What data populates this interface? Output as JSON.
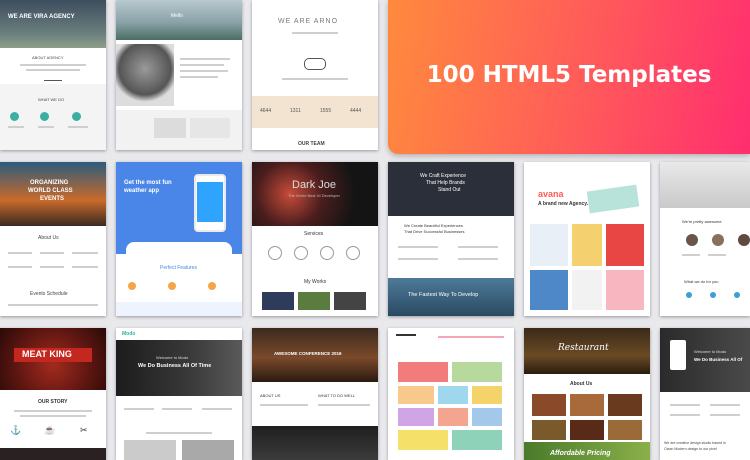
{
  "banner": {
    "title": "100 HTML5 Templates"
  },
  "tiles": {
    "t1": {
      "headline": "WE ARE VIRA AGENCY",
      "about": "ABOUT AGENCY",
      "what": "WHAT WE DO"
    },
    "t2": {
      "name": "Mello"
    },
    "t3": {
      "headline": "WE ARE ARNO",
      "stats": [
        "4644",
        "1311",
        "1555",
        "4444"
      ],
      "team": "OUR TEAM"
    },
    "t4": {
      "headline1": "ORGANIZING",
      "headline2": "WORLD CLASS",
      "headline3": "EVENTS",
      "about": "About Us",
      "schedule": "Events Schedule"
    },
    "t5": {
      "headline1": "Get the most fun",
      "headline2": "weather app",
      "features": "Perfect Features"
    },
    "t6": {
      "title": "Dark Joe",
      "subtitle": "The World Best UI Developer",
      "services": "Services",
      "works": "My Works"
    },
    "t7": {
      "headline1": "We Craft Experience",
      "headline2": "That Help Brands",
      "headline3": "Stand Out",
      "headline4": "We Create Beautiful Experiences",
      "headline5": "That Drive Successful Businesses",
      "cta": "The Fastest Way To Develop"
    },
    "t8": {
      "brand": "avana",
      "tagline": "A brand new Agency."
    },
    "t9": {
      "headline": "We're pretty awesome",
      "section": "What we do for you"
    },
    "t10": {
      "title": "MEAT KING",
      "story": "OUR STORY"
    },
    "t11": {
      "logo": "Modo",
      "headline1": "Welcome to Modo",
      "headline2": "We Do Business All Of Time"
    },
    "t12": {
      "title": "AWESOME CONFERENCE 2016",
      "about": "ABOUT US",
      "what": "WHAT TO DO WELL"
    },
    "t14": {
      "title": "Restaurant",
      "about": "About Us",
      "pricing": "Affordable Pricing"
    },
    "t15": {
      "headline1": "Welcome to Modo",
      "headline2": "We Do Business All Of",
      "footer1": "We are creative design studio based in",
      "footer2": "Clean Modern design to our pixel"
    }
  }
}
